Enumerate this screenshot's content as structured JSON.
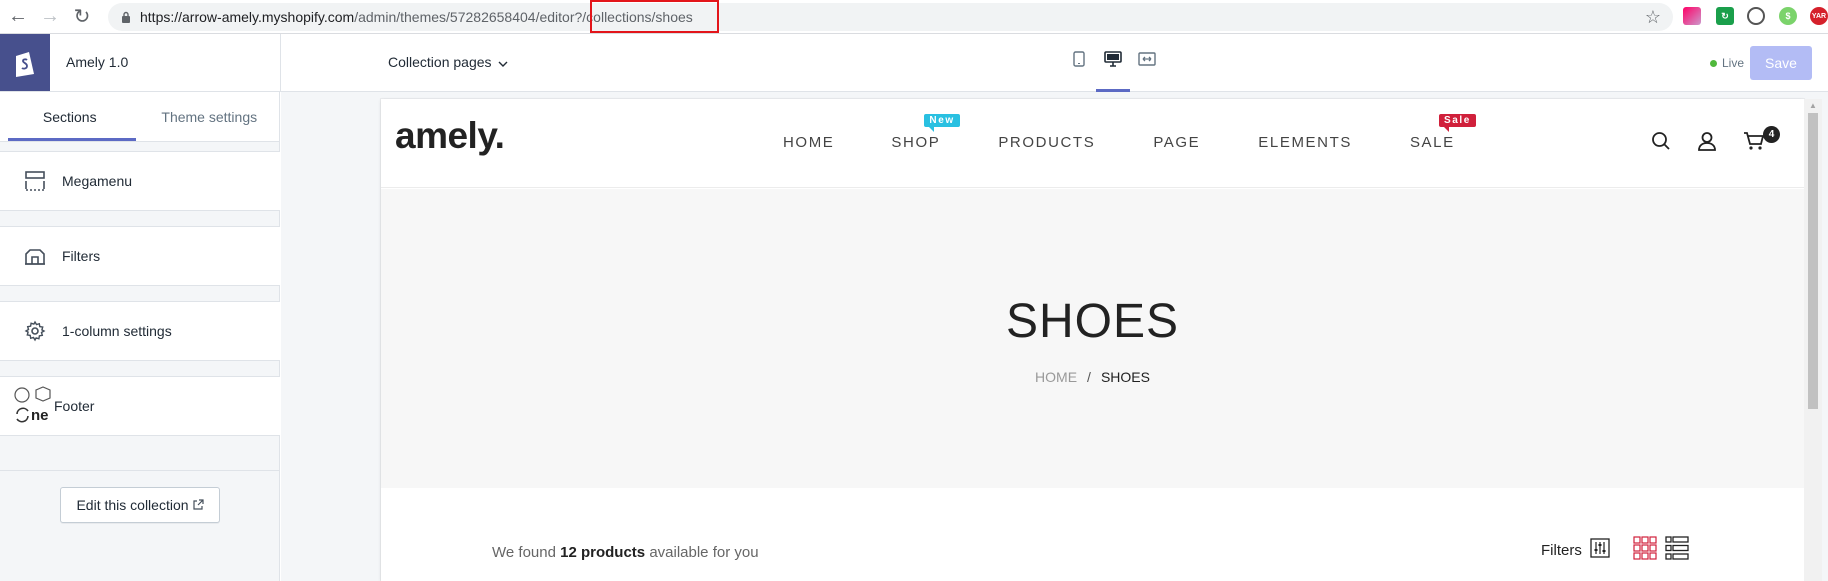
{
  "browser": {
    "url_host": "https://arrow-amely.myshopify.com",
    "url_path_a": "/admin/themes/57282658404/editor",
    "url_path_b": "?/collections/shoes"
  },
  "editor": {
    "theme_name": "Amely 1.0",
    "page_select": "Collection pages",
    "live_label": "Live",
    "save_label": "Save"
  },
  "sidebar": {
    "tabs": [
      "Sections",
      "Theme settings"
    ],
    "sections": [
      {
        "label": "Megamenu",
        "icon": "megamenu-icon"
      },
      {
        "label": "Filters",
        "icon": "filters-section-icon"
      },
      {
        "label": "1-column settings",
        "icon": "gear-icon"
      },
      {
        "label": "Footer",
        "icon": "footer-icon"
      }
    ],
    "edit_button": "Edit this collection"
  },
  "store": {
    "logo": "amely.",
    "menu": [
      "HOME",
      "SHOP",
      "PRODUCTS",
      "PAGE",
      "ELEMENTS",
      "SALE"
    ],
    "badge_new": "New",
    "badge_sale": "Sale",
    "cart_count": "4",
    "hero_title": "SHOES",
    "crumb_home": "HOME",
    "crumb_sep": "/",
    "crumb_current": "SHOES",
    "found_prefix": "We found",
    "found_count": "12 products",
    "found_suffix": "available for you",
    "filters_label": "Filters"
  },
  "colors": {
    "brand": "#47508d",
    "accent": "#5c6ac4",
    "badge_new": "#29c0e1",
    "badge_sale": "#d0203b",
    "view_icon": "#d0203b"
  }
}
